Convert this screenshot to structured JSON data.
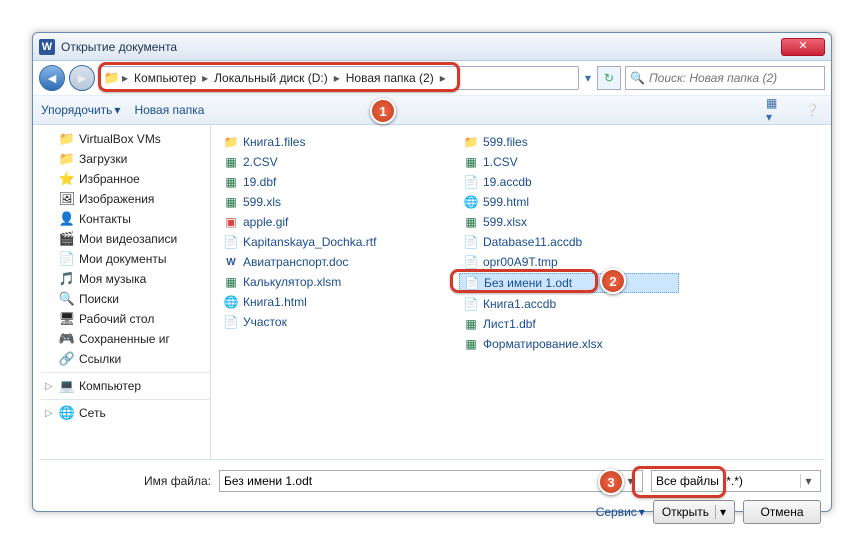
{
  "title": "Открытие документа",
  "breadcrumb": [
    "Компьютер",
    "Локальный диск (D:)",
    "Новая папка (2)"
  ],
  "search_placeholder": "Поиск: Новая папка (2)",
  "toolbar": {
    "organize": "Упорядочить",
    "newfolder": "Новая папка"
  },
  "tree": [
    {
      "label": "VirtualBox VMs",
      "icon": "fld"
    },
    {
      "label": "Загрузки",
      "icon": "fld"
    },
    {
      "label": "Избранное",
      "icon": "star"
    },
    {
      "label": "Изображения",
      "icon": "pic"
    },
    {
      "label": "Контакты",
      "icon": "contact"
    },
    {
      "label": "Мои видеозаписи",
      "icon": "vid"
    },
    {
      "label": "Мои документы",
      "icon": "doc"
    },
    {
      "label": "Моя музыка",
      "icon": "mus"
    },
    {
      "label": "Поиски",
      "icon": "search"
    },
    {
      "label": "Рабочий стол",
      "icon": "desk"
    },
    {
      "label": "Сохраненные игры",
      "icon": "game",
      "trunc": "Сохраненные иг"
    },
    {
      "label": "Ссылки",
      "icon": "link"
    }
  ],
  "tree_roots": {
    "computer": "Компьютер",
    "network": "Сеть"
  },
  "files_col1": [
    {
      "name": "Книга1.files",
      "icon": "fld"
    },
    {
      "name": "2.CSV",
      "icon": "exc"
    },
    {
      "name": "19.dbf",
      "icon": "exc"
    },
    {
      "name": "599.xls",
      "icon": "exc"
    },
    {
      "name": "apple.gif",
      "icon": "gif"
    },
    {
      "name": "Kapitanskaya_Dochka.rtf",
      "icon": "rtf"
    },
    {
      "name": "Авиатранспорт.doc",
      "icon": "wrd"
    },
    {
      "name": "Калькулятор.xlsm",
      "icon": "exc"
    },
    {
      "name": "Книга1.html",
      "icon": "htm"
    },
    {
      "name": "Участок",
      "icon": "gen"
    }
  ],
  "files_col2": [
    {
      "name": "599.files",
      "icon": "fld"
    },
    {
      "name": "1.CSV",
      "icon": "exc"
    },
    {
      "name": "19.accdb",
      "icon": "gen"
    },
    {
      "name": "599.html",
      "icon": "htm"
    },
    {
      "name": "599.xlsx",
      "icon": "exc"
    },
    {
      "name": "Database11.accdb",
      "icon": "gen"
    },
    {
      "name": "opr00A9T.tmp",
      "icon": "gen"
    },
    {
      "name": "Без имени 1.odt",
      "icon": "odt",
      "sel": true
    },
    {
      "name": "Книга1.accdb",
      "icon": "gen"
    },
    {
      "name": "Лист1.dbf",
      "icon": "exc"
    },
    {
      "name": "Форматирование.xlsx",
      "icon": "exc"
    }
  ],
  "bottom": {
    "fname_label": "Имя файла:",
    "fname_value": "Без имени 1.odt",
    "ftype_value": "Все файлы (*.*)",
    "service": "Сервис",
    "open": "Открыть",
    "cancel": "Отмена"
  },
  "badges": {
    "b1": "1",
    "b2": "2",
    "b3": "3"
  }
}
